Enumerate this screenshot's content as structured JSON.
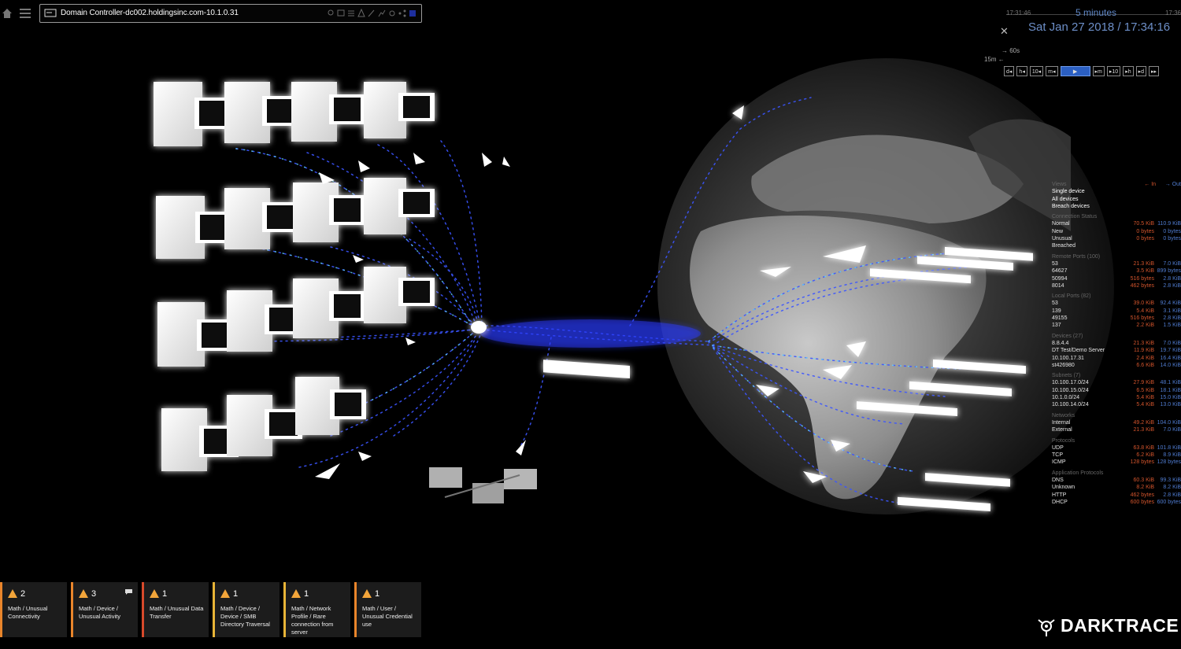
{
  "header": {
    "device_name": "Domain Controller-dc002.holdingsinc.com-10.1.0.31"
  },
  "time_panel": {
    "range_label": "5 minutes",
    "tick_left": "17:31:46",
    "tick_right": "17:36",
    "datetime": "Sat Jan 27 2018 / 17:34:16",
    "step_60": "→ 60s",
    "step_15": "15m ←",
    "buttons_left": [
      "d",
      "h",
      "10",
      "m"
    ],
    "buttons_right": [
      "m",
      "10",
      "h",
      "d"
    ]
  },
  "stats": {
    "views_header": "Views",
    "views": [
      "Single device",
      "All devices",
      "Breach devices"
    ],
    "in_label": "← In",
    "out_label": "→ Out",
    "sections": [
      {
        "header": "Connection Status",
        "rows": [
          {
            "label": "Normal",
            "in": "70.5 KiB",
            "out": "110.9 KiB"
          },
          {
            "label": "New",
            "in": "0 bytes",
            "out": "0 bytes"
          },
          {
            "label": "Unusual",
            "in": "0 bytes",
            "out": "0 bytes"
          },
          {
            "label": "Breached",
            "in": "",
            "out": ""
          }
        ]
      },
      {
        "header": "Remote Ports (100)",
        "rows": [
          {
            "label": "53",
            "in": "21.3 KiB",
            "out": "7.0 KiB"
          },
          {
            "label": "64627",
            "in": "3.5 KiB",
            "out": "899 bytes"
          },
          {
            "label": "50994",
            "in": "516 bytes",
            "out": "2.8 KiB"
          },
          {
            "label": "8014",
            "in": "462 bytes",
            "out": "2.8 KiB"
          }
        ]
      },
      {
        "header": "Local Ports (82)",
        "rows": [
          {
            "label": "53",
            "in": "39.0 KiB",
            "out": "92.4 KiB"
          },
          {
            "label": "139",
            "in": "5.4 KiB",
            "out": "3.1 KiB"
          },
          {
            "label": "49155",
            "in": "516 bytes",
            "out": "2.8 KiB"
          },
          {
            "label": "137",
            "in": "2.2 KiB",
            "out": "1.5 KiB"
          }
        ]
      },
      {
        "header": "Devices (27)",
        "rows": [
          {
            "label": "8.8.4.4",
            "in": "21.3 KiB",
            "out": "7.0 KiB"
          },
          {
            "label": "DT Test/Demo Server",
            "in": "11.9 KiB",
            "out": "19.7 KiB"
          },
          {
            "label": "10.100.17.31",
            "in": "2.4 KiB",
            "out": "16.4 KiB"
          },
          {
            "label": "st426980",
            "in": "6.6 KiB",
            "out": "14.0 KiB"
          }
        ]
      },
      {
        "header": "Subnets (7)",
        "rows": [
          {
            "label": "10.100.17.0/24",
            "in": "27.9 KiB",
            "out": "48.1 KiB"
          },
          {
            "label": "10.100.15.0/24",
            "in": "6.5 KiB",
            "out": "18.1 KiB"
          },
          {
            "label": "10.1.0.0/24",
            "in": "5.4 KiB",
            "out": "15.0 KiB"
          },
          {
            "label": "10.100.14.0/24",
            "in": "5.4 KiB",
            "out": "13.0 KiB"
          }
        ]
      },
      {
        "header": "Networks",
        "rows": [
          {
            "label": "Internal",
            "in": "49.2 KiB",
            "out": "104.0 KiB"
          },
          {
            "label": "External",
            "in": "21.3 KiB",
            "out": "7.0 KiB"
          }
        ]
      },
      {
        "header": "Protocols",
        "rows": [
          {
            "label": "UDP",
            "in": "63.8 KiB",
            "out": "101.8 KiB"
          },
          {
            "label": "TCP",
            "in": "6.2 KiB",
            "out": "8.9 KiB"
          },
          {
            "label": "ICMP",
            "in": "128 bytes",
            "out": "128 bytes"
          }
        ]
      },
      {
        "header": "Application Protocols",
        "rows": [
          {
            "label": "DNS",
            "in": "60.3 KiB",
            "out": "99.3 KiB"
          },
          {
            "label": "Unknown",
            "in": "8.2 KiB",
            "out": "8.2 KiB"
          },
          {
            "label": "HTTP",
            "in": "462 bytes",
            "out": "2.8 KiB"
          },
          {
            "label": "DHCP",
            "in": "600 bytes",
            "out": "600 bytes"
          }
        ]
      }
    ]
  },
  "alerts": [
    {
      "count": "2",
      "title": "Math / Unusual Connectivity",
      "color": "#e9852b",
      "has_comment": false
    },
    {
      "count": "3",
      "title": "Math / Device / Unusual Activity",
      "color": "#e9852b",
      "has_comment": true
    },
    {
      "count": "1",
      "title": "Math / Unusual Data Transfer",
      "color": "#d84a2b",
      "has_comment": false
    },
    {
      "count": "1",
      "title": "Math / Device / Device / SMB Directory Traversal",
      "color": "#e8b437",
      "has_comment": false
    },
    {
      "count": "1",
      "title": "Math / Network Profile / Rare connection from server",
      "color": "#e8b437",
      "has_comment": false
    },
    {
      "count": "1",
      "title": "Math / User / Unusual Credential use",
      "color": "#e9852b",
      "has_comment": false
    }
  ],
  "brand": {
    "logo_text": "DARKTRACE"
  },
  "colors": {
    "accent": "#5f87c6",
    "in": "#d2542c",
    "out": "#4f7bcf",
    "flow": "#3b55ff"
  }
}
